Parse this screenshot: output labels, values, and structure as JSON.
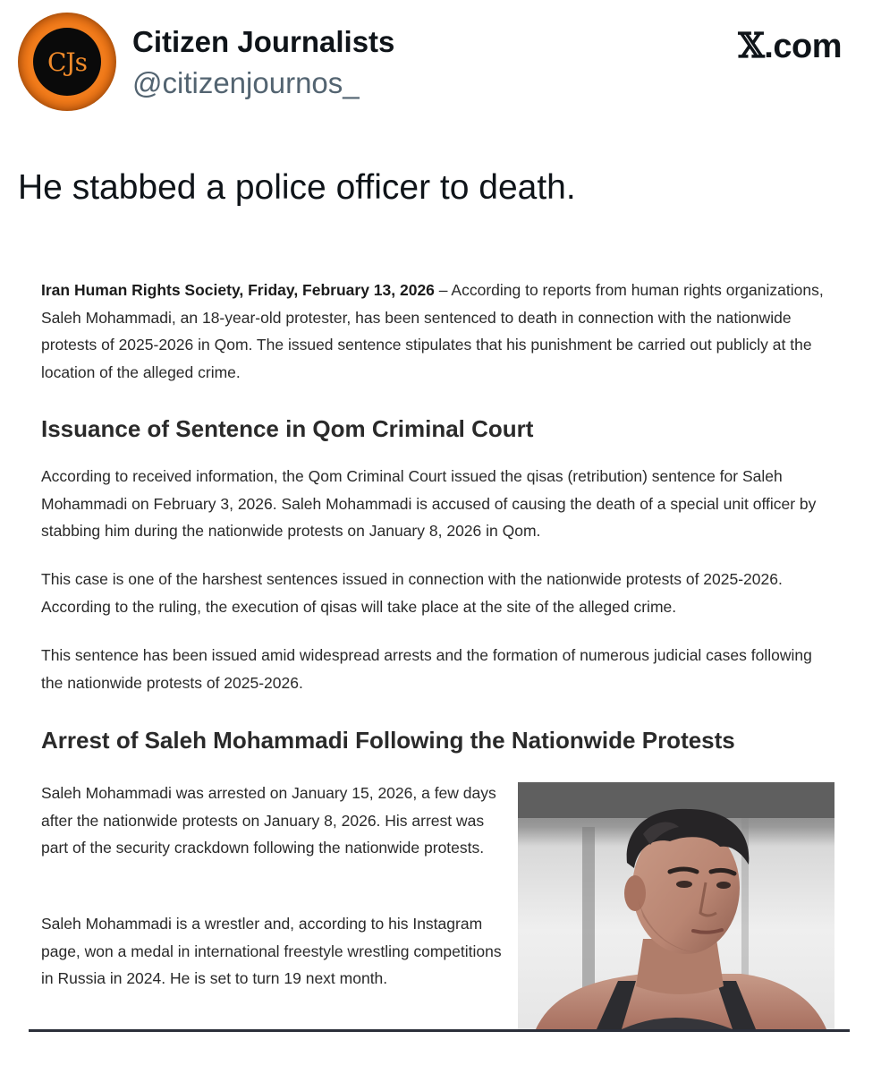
{
  "tweet": {
    "avatar_text": "CJs",
    "display_name": "Citizen Journalists",
    "handle": "@citizenjournos_",
    "brand_glyph": "𝕏",
    "brand_suffix": ".com",
    "text": "He stabbed a police officer to death."
  },
  "article": {
    "intro_lead": "Iran Human Rights Society, Friday, February 13, 2026",
    "intro_rest": " – According to reports from human rights organizations, Saleh Mohammadi, an 18-year-old protester, has been sentenced to death in connection with the nationwide protests of 2025-2026 in Qom. The issued sentence stipulates that his punishment be carried out publicly at the location of the alleged crime.",
    "heading_1": "Issuance of Sentence in Qom Criminal Court",
    "para_1": "According to received information, the Qom Criminal Court issued the qisas (retribution) sentence for Saleh Mohammadi on February 3, 2026. Saleh Mohammadi is accused of causing the death of a special unit officer by stabbing him during the nationwide protests on January 8, 2026 in Qom.",
    "para_2": "This case is one of the harshest sentences issued in connection with the nationwide protests of 2025-2026. According to the ruling, the execution of qisas will take place at the site of the alleged crime.",
    "para_3": "This sentence has been issued amid widespread arrests and the formation of numerous judicial cases following the nationwide protests of 2025-2026.",
    "heading_2": "Arrest of Saleh Mohammadi Following the Nationwide Protests",
    "para_4": "Saleh Mohammadi was arrested on January 15, 2026, a few days after the nationwide protests on January 8, 2026. His arrest was part of the security crackdown following the nationwide protests.",
    "para_5": "Saleh Mohammadi is a wrestler and, according to his Instagram page, won a medal in international freestyle wrestling competitions in Russia in 2024. He is set to turn 19 next month."
  },
  "colors": {
    "avatar_orange": "#f07a1a",
    "handle_gray": "#536471",
    "article_text": "#2a2a2a",
    "article_rule": "#2b2f3a"
  },
  "icons": {
    "brand": "x-logo-icon",
    "photo": "wrestler-portrait-photo"
  }
}
